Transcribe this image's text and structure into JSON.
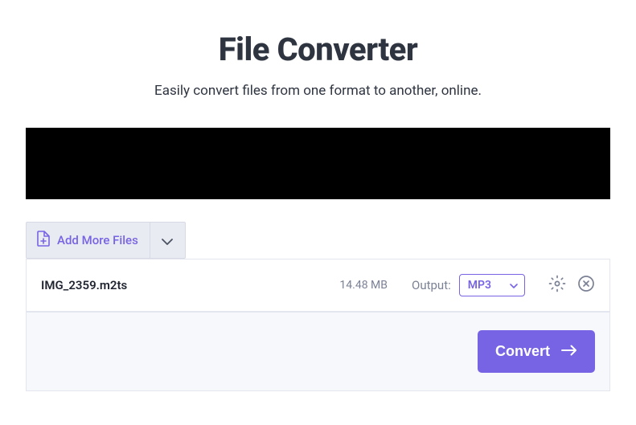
{
  "header": {
    "title": "File Converter",
    "subtitle": "Easily convert files from one format to another, online."
  },
  "toolbar": {
    "add_more_files_label": "Add More Files"
  },
  "files": [
    {
      "name": "IMG_2359.m2ts",
      "size": "14.48 MB",
      "output_label": "Output:",
      "output_format": "MP3"
    }
  ],
  "actions": {
    "convert_label": "Convert"
  },
  "colors": {
    "accent": "#7764e4",
    "text_dark": "#2e3440",
    "text_muted": "#7b8194"
  }
}
